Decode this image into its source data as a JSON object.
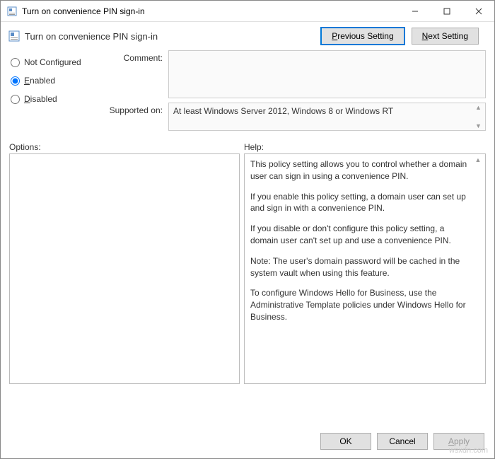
{
  "titlebar": {
    "title": "Turn on convenience PIN sign-in"
  },
  "header": {
    "policy_name": "Turn on convenience PIN sign-in",
    "prev_underline": "P",
    "prev_rest": "revious Setting",
    "next_underline": "N",
    "next_rest": "ext Setting"
  },
  "state": {
    "options": [
      "Not Configured",
      "Enabled",
      "Disabled"
    ],
    "selected": "Enabled",
    "enabled_u": "E",
    "enabled_rest": "nabled",
    "disabled_u": "D",
    "disabled_rest": "isabled"
  },
  "fields": {
    "comment_label": "Comment:",
    "comment_value": "",
    "supported_label": "Supported on:",
    "supported_value": "At least Windows Server 2012, Windows 8 or Windows RT"
  },
  "panes": {
    "options_label": "Options:",
    "help_label": "Help:"
  },
  "help": {
    "p1": "This policy setting allows you to control whether a domain user can sign in using a convenience PIN.",
    "p2": "If you enable this policy setting, a domain user can set up and sign in with a convenience PIN.",
    "p3": "If you disable or don't configure this policy setting, a domain user can't set up and use a convenience PIN.",
    "p4": "Note: The user's domain password will be cached in the system vault when using this feature.",
    "p5": "To configure Windows Hello for Business, use the Administrative Template policies under Windows Hello for Business."
  },
  "footer": {
    "ok": "OK",
    "cancel": "Cancel",
    "apply_u": "A",
    "apply_rest": "pply"
  },
  "watermark": "wsxdn.com"
}
